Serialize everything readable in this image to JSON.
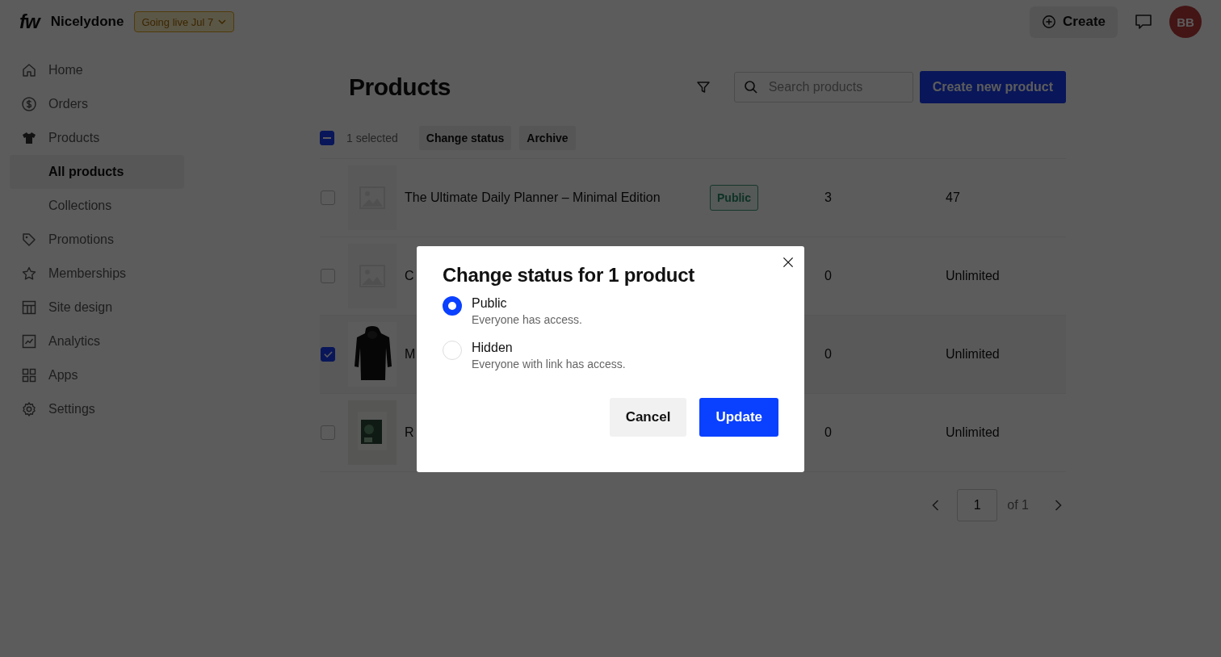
{
  "topbar": {
    "brand": "fw",
    "store": "Nicelydone",
    "launch_badge": "Going live Jul 7",
    "create_label": "Create",
    "avatar": "BB"
  },
  "sidebar": {
    "items": [
      {
        "label": "Home",
        "selected": false
      },
      {
        "label": "Orders",
        "selected": false
      },
      {
        "label": "Products",
        "selected": false,
        "children": [
          {
            "label": "All products",
            "selected": true
          },
          {
            "label": "Collections",
            "selected": false
          }
        ]
      },
      {
        "label": "Promotions",
        "selected": false
      },
      {
        "label": "Memberships",
        "selected": false
      },
      {
        "label": "Site design",
        "selected": false
      },
      {
        "label": "Analytics",
        "selected": false
      },
      {
        "label": "Apps",
        "selected": false
      },
      {
        "label": "Settings",
        "selected": false
      }
    ]
  },
  "page": {
    "title": "Products",
    "search": {
      "placeholder": "Search products"
    },
    "primary_button": "Create new product"
  },
  "bulk": {
    "indeterminate": true,
    "count_label": "1 selected",
    "actions": [
      "Change status",
      "Archive"
    ]
  },
  "table": {
    "rows": [
      {
        "selected": false,
        "kind": "placeholder",
        "name": "The Ultimate Daily Planner – Minimal Edition",
        "status": "Public",
        "column_3": "3",
        "column_4": "47"
      },
      {
        "selected": false,
        "kind": "placeholder",
        "name": "C",
        "column_3": "0",
        "column_4": "Unlimited"
      },
      {
        "selected": true,
        "kind": "picture",
        "name": "M",
        "column_3": "0",
        "column_4": "Unlimited"
      },
      {
        "selected": false,
        "kind": "picture",
        "name": "R",
        "column_3": "0",
        "column_4": "Unlimited"
      }
    ]
  },
  "pagination": {
    "page": "1",
    "of_label": "of 1"
  },
  "dialog": {
    "title": "Change status for 1 product",
    "options": [
      {
        "label": "Public",
        "description": "Everyone has access.",
        "selected": true
      },
      {
        "label": "Hidden",
        "description": "Everyone with link has access.",
        "selected": false
      }
    ],
    "buttons": [
      {
        "label": "Cancel",
        "kind": "secondary"
      },
      {
        "label": "Update",
        "kind": "primary"
      }
    ]
  }
}
